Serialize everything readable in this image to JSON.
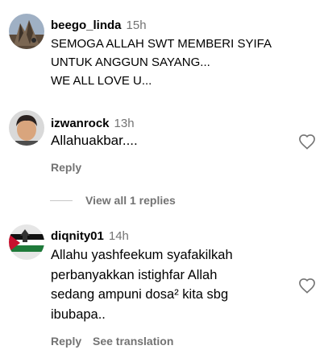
{
  "comments": [
    {
      "username": "beego_linda",
      "time": "15h",
      "text": "SEMOGA ALLAH SWT MEMBERI SYIFA\nUNTUK ANGGUN SAYANG...\nWE ALL LOVE U..."
    },
    {
      "username": "izwanrock",
      "time": "13h",
      "text": "Allahuakbar....",
      "reply_label": "Reply",
      "view_replies_label": "View all 1 replies"
    },
    {
      "username": "diqnity01",
      "time": "14h",
      "text": "Allahu yashfeekum syafakilkah\nperbanyakkan istighfar Allah\nsedang ampuni dosa² kita sbg\nibubapa..",
      "reply_label": "Reply",
      "translate_label": "See translation"
    }
  ],
  "icons": {
    "like": "heart-outline-icon"
  },
  "colors": {
    "secondary_text": "#737373",
    "divider": "#c7c7c7",
    "heart_stroke": "#737373"
  }
}
